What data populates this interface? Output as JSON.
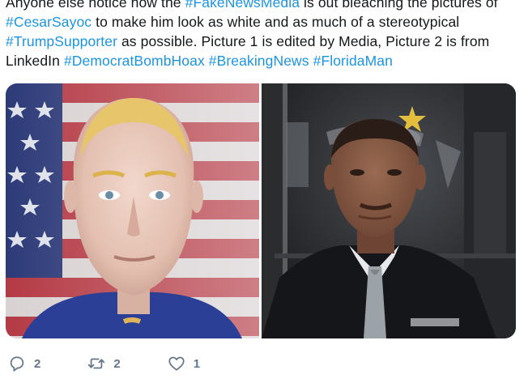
{
  "tweet": {
    "lines": [
      [
        {
          "t": "Anyone else notice how the ",
          "h": false
        },
        {
          "t": "#FakeNewsMedia",
          "h": true
        },
        {
          "t": " is out bleaching the pictures of",
          "h": false
        }
      ],
      [
        {
          "t": "#CesarSayoc",
          "h": true
        },
        {
          "t": " to make him look as white and as much of a stereotypical",
          "h": false
        }
      ],
      [
        {
          "t": "#TrumpSupporter",
          "h": true
        },
        {
          "t": " as possible. Picture 1 is edited by Media, Picture 2 is from",
          "h": false
        }
      ],
      [
        {
          "t": "LinkedIn ",
          "h": false
        },
        {
          "t": "#DemocratBombHoax",
          "h": true
        },
        {
          "t": " ",
          "h": false
        },
        {
          "t": "#BreakingNews",
          "h": true
        },
        {
          "t": " ",
          "h": false
        },
        {
          "t": "#FloridaMan",
          "h": true
        }
      ]
    ]
  },
  "media": {
    "photos": [
      {
        "name": "photo-1",
        "depicts": "edited-mugshot-portrait"
      },
      {
        "name": "photo-2",
        "depicts": "linkedin-portrait"
      }
    ]
  },
  "actions": {
    "reply": {
      "icon": "reply-icon",
      "count": "2"
    },
    "retweet": {
      "icon": "retweet-icon",
      "count": "2"
    },
    "like": {
      "icon": "heart-icon",
      "count": "1"
    }
  },
  "colors": {
    "hashtag": "#1b95e0",
    "text": "#14171a",
    "action_gray": "#657786"
  }
}
